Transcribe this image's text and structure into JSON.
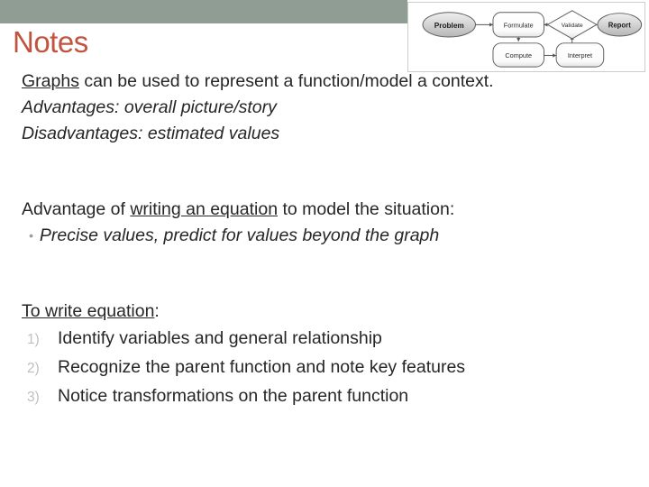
{
  "slide": {
    "title": "Notes",
    "title_color": "#c0543f",
    "bar_color": "#8f9d94"
  },
  "body": {
    "line1": {
      "underlined": "Graphs",
      "rest": " can be used to represent a function/model a context."
    },
    "line2": "Advantages: overall picture/story",
    "line3": "Disadvantages: estimated values",
    "line4": {
      "before": "Advantage of ",
      "underlined": "writing an equation",
      "after": " to model the situation:"
    },
    "bullet": {
      "marker": "•",
      "text": "Precise values, predict for values beyond the graph"
    },
    "line5": {
      "underlined": "To write equation",
      "after": ":"
    },
    "numbered": [
      {
        "marker": "1)",
        "text": "Identify variables and general relationship"
      },
      {
        "marker": "2)",
        "text": "Recognize the parent function and note key features"
      },
      {
        "marker": "3)",
        "text": "Notice transformations on the parent function"
      }
    ]
  },
  "diagram": {
    "name": "modeling-cycle-flow-diagram",
    "nodes": [
      {
        "id": "problem",
        "label": "Problem",
        "shape": "ellipse",
        "fill": "#cfcfcf"
      },
      {
        "id": "formulate",
        "label": "Formulate",
        "shape": "rounded",
        "fill": "#ffffff"
      },
      {
        "id": "validate",
        "label": "Validate",
        "shape": "diamond",
        "fill": "#ffffff"
      },
      {
        "id": "report",
        "label": "Report",
        "shape": "ellipse",
        "fill": "#cfcfcf"
      },
      {
        "id": "compute",
        "label": "Compute",
        "shape": "rounded",
        "fill": "#ffffff"
      },
      {
        "id": "interpret",
        "label": "Interpret",
        "shape": "rounded",
        "fill": "#ffffff"
      }
    ],
    "edges": [
      {
        "from": "problem",
        "to": "formulate"
      },
      {
        "from": "validate",
        "to": "formulate"
      },
      {
        "from": "validate",
        "to": "report"
      },
      {
        "from": "formulate",
        "to": "compute"
      },
      {
        "from": "compute",
        "to": "interpret"
      },
      {
        "from": "interpret",
        "to": "validate"
      }
    ]
  }
}
